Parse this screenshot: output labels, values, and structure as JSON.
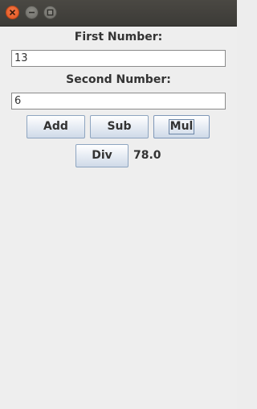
{
  "window": {
    "controls": {
      "close": "close-icon",
      "minimize": "minimize-icon",
      "maximize": "maximize-icon"
    }
  },
  "form": {
    "first_label": "First Number:",
    "first_value": "13",
    "second_label": "Second Number:",
    "second_value": "6"
  },
  "buttons": {
    "add": "Add",
    "sub": "Sub",
    "mul": "Mul",
    "div": "Div"
  },
  "result": "78.0",
  "colors": {
    "close_button": "#e2531d",
    "titlebar": "#3c3b37",
    "background": "#eeeeee"
  }
}
